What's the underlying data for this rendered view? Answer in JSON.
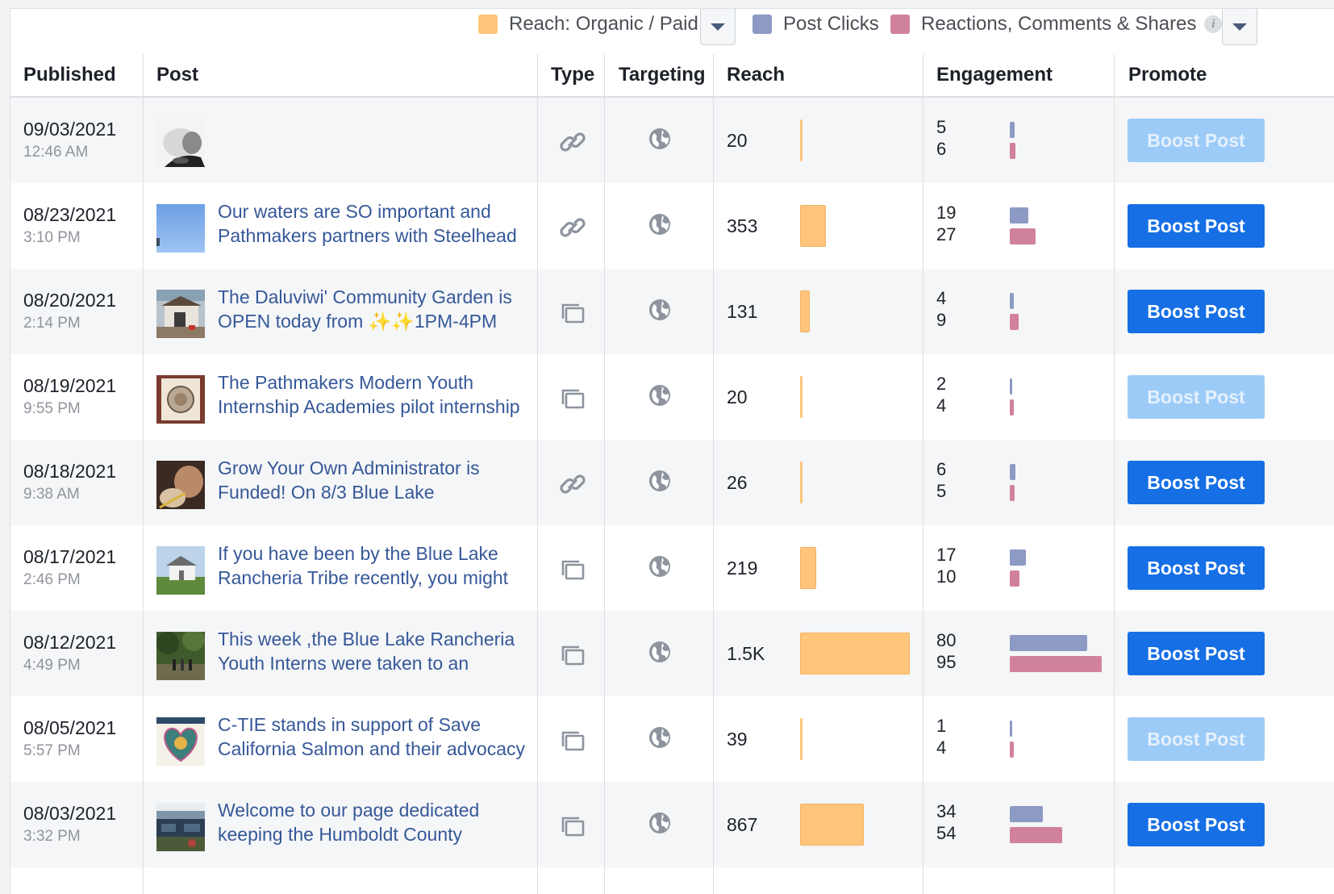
{
  "legend": {
    "reach_label": "Reach: Organic / Paid",
    "clicks_label": "Post Clicks",
    "reactions_label": "Reactions, Comments & Shares",
    "info_symbol": "i",
    "colors": {
      "reach": "#ffc57a",
      "clicks": "#8c9ac4",
      "reactions": "#d1829b"
    }
  },
  "columns": {
    "published": "Published",
    "post": "Post",
    "type": "Type",
    "targeting": "Targeting",
    "reach": "Reach",
    "engagement": "Engagement",
    "promote": "Promote"
  },
  "rows": [
    {
      "date": "09/03/2021",
      "time": "12:46 AM",
      "text": "",
      "type_icon": "link-icon",
      "targeting_icon": "globe-icon",
      "reach": "20",
      "reach_value": 20,
      "clicks": "5",
      "reactions": "6",
      "boost_label": "Boost Post",
      "boost_enabled": false
    },
    {
      "date": "08/23/2021",
      "time": "3:10 PM",
      "text": "Our waters are SO important and Pathmakers partners with Steelhead",
      "type_icon": "link-icon",
      "targeting_icon": "globe-icon",
      "reach": "353",
      "reach_value": 353,
      "clicks": "19",
      "reactions": "27",
      "boost_label": "Boost Post",
      "boost_enabled": true
    },
    {
      "date": "08/20/2021",
      "time": "2:14 PM",
      "text": "The Daluviwi' Community Garden is OPEN today from ✨✨1PM-4PM",
      "type_icon": "album-icon",
      "targeting_icon": "globe-icon",
      "reach": "131",
      "reach_value": 131,
      "clicks": "4",
      "reactions": "9",
      "boost_label": "Boost Post",
      "boost_enabled": true
    },
    {
      "date": "08/19/2021",
      "time": "9:55 PM",
      "text": "The Pathmakers Modern Youth Internship Academies pilot internship",
      "type_icon": "album-icon",
      "targeting_icon": "globe-icon",
      "reach": "20",
      "reach_value": 20,
      "clicks": "2",
      "reactions": "4",
      "boost_label": "Boost Post",
      "boost_enabled": false
    },
    {
      "date": "08/18/2021",
      "time": "9:38 AM",
      "text": "Grow Your Own Administrator is Funded! On 8/3 Blue Lake",
      "type_icon": "link-icon",
      "targeting_icon": "globe-icon",
      "reach": "26",
      "reach_value": 26,
      "clicks": "6",
      "reactions": "5",
      "boost_label": "Boost Post",
      "boost_enabled": true
    },
    {
      "date": "08/17/2021",
      "time": "2:46 PM",
      "text": "If you have been by the Blue Lake Rancheria Tribe recently, you might",
      "type_icon": "album-icon",
      "targeting_icon": "globe-icon",
      "reach": "219",
      "reach_value": 219,
      "clicks": "17",
      "reactions": "10",
      "boost_label": "Boost Post",
      "boost_enabled": true
    },
    {
      "date": "08/12/2021",
      "time": "4:49 PM",
      "text": "This week ,the Blue Lake Rancheria Youth Interns were taken to an",
      "type_icon": "album-icon",
      "targeting_icon": "globe-icon",
      "reach": "1.5K",
      "reach_value": 1500,
      "clicks": "80",
      "reactions": "95",
      "boost_label": "Boost Post",
      "boost_enabled": true
    },
    {
      "date": "08/05/2021",
      "time": "5:57 PM",
      "text": "C-TIE stands in support of Save California Salmon and their advocacy",
      "type_icon": "album-icon",
      "targeting_icon": "globe-icon",
      "reach": "39",
      "reach_value": 39,
      "clicks": "1",
      "reactions": "4",
      "boost_label": "Boost Post",
      "boost_enabled": false
    },
    {
      "date": "08/03/2021",
      "time": "3:32 PM",
      "text": "Welcome to our page dedicated keeping the Humboldt County",
      "type_icon": "album-icon",
      "targeting_icon": "globe-icon",
      "reach": "867",
      "reach_value": 867,
      "clicks": "34",
      "reactions": "54",
      "boost_label": "Boost Post",
      "boost_enabled": true
    }
  ]
}
